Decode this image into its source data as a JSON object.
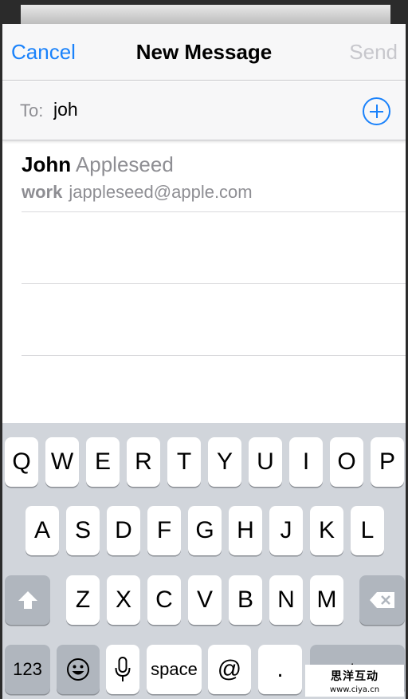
{
  "nav": {
    "cancel": "Cancel",
    "title": "New Message",
    "send": "Send"
  },
  "to": {
    "label": "To:",
    "value": "joh"
  },
  "suggestion": {
    "first": "John",
    "last": "Appleseed",
    "type": "work",
    "email": "jappleseed@apple.com"
  },
  "keyboard": {
    "row1": [
      "Q",
      "W",
      "E",
      "R",
      "T",
      "Y",
      "U",
      "I",
      "O",
      "P"
    ],
    "row2": [
      "A",
      "S",
      "D",
      "F",
      "G",
      "H",
      "J",
      "K",
      "L"
    ],
    "row3": [
      "Z",
      "X",
      "C",
      "V",
      "B",
      "N",
      "M"
    ],
    "numbers": "123",
    "space": "space",
    "at": "@",
    "dot": ".",
    "return": "return",
    "shift_icon": "shift-icon",
    "delete_icon": "delete-icon",
    "emoji_icon": "emoji-icon",
    "mic_icon": "microphone-icon"
  },
  "watermark": {
    "cn": "思洋互动",
    "url": "www.ciya.cn"
  },
  "colors": {
    "accent": "#1a82fb",
    "disabled": "#c7c7cc",
    "secondary": "#8e8e93"
  }
}
